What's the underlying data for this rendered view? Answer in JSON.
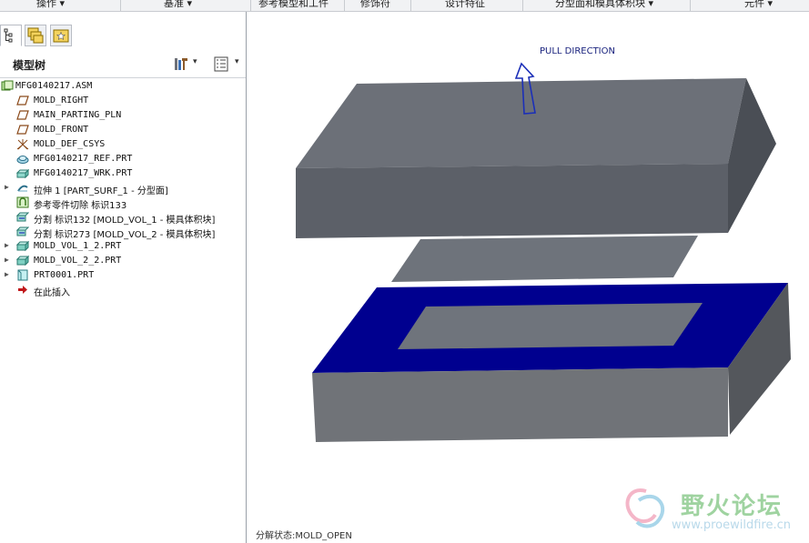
{
  "menubar": {
    "items": [
      {
        "label": "操作",
        "arrow": "▾"
      },
      {
        "label": "基准",
        "arrow": "▾"
      },
      {
        "label": "参考模型和工件",
        "arrow": ""
      },
      {
        "label": "修饰符",
        "arrow": ""
      },
      {
        "label": "设计特征",
        "arrow": ""
      },
      {
        "label": "分型面和模具体积块",
        "arrow": "▾"
      },
      {
        "label": "元件",
        "arrow": "▾"
      }
    ]
  },
  "tabs": [
    {
      "icon": "model-tree-icon"
    },
    {
      "icon": "layers-icon"
    },
    {
      "icon": "favorites-icon"
    }
  ],
  "tree_header": {
    "title": "模型树",
    "settings_icon": "tree-settings-icon",
    "columns_icon": "tree-columns-icon",
    "dropdown": "▾"
  },
  "tree": {
    "items": [
      {
        "label": "MFG0140217.ASM",
        "icon": "assembly-icon",
        "expandable": false,
        "indent": 0
      },
      {
        "label": "MOLD_RIGHT",
        "icon": "datum-plane-icon",
        "expandable": false,
        "indent": 1
      },
      {
        "label": "MAIN_PARTING_PLN",
        "icon": "datum-plane-icon",
        "expandable": false,
        "indent": 1
      },
      {
        "label": "MOLD_FRONT",
        "icon": "datum-plane-icon",
        "expandable": false,
        "indent": 1
      },
      {
        "label": "MOLD_DEF_CSYS",
        "icon": "csys-icon",
        "expandable": false,
        "indent": 1
      },
      {
        "label": "MFG0140217_REF.PRT",
        "icon": "ref-part-icon",
        "expandable": false,
        "indent": 1
      },
      {
        "label": "MFG0140217_WRK.PRT",
        "icon": "workpiece-icon",
        "expandable": false,
        "indent": 1
      },
      {
        "label": "拉伸 1 [PART_SURF_1 - 分型面]",
        "icon": "extrude-icon",
        "expandable": true,
        "indent": 1
      },
      {
        "label": "参考零件切除 标识133",
        "icon": "ref-cut-icon",
        "expandable": false,
        "indent": 1
      },
      {
        "label": "分割 标识132 [MOLD_VOL_1 - 模具体积块]",
        "icon": "split-icon",
        "expandable": false,
        "indent": 1
      },
      {
        "label": "分割 标识273 [MOLD_VOL_2 - 模具体积块]",
        "icon": "split-icon",
        "expandable": false,
        "indent": 1
      },
      {
        "label": "MOLD_VOL_1_2.PRT",
        "icon": "mold-part-icon",
        "expandable": true,
        "indent": 1
      },
      {
        "label": "MOLD_VOL_2_2.PRT",
        "icon": "mold-part-icon",
        "expandable": true,
        "indent": 1
      },
      {
        "label": "PRT0001.PRT",
        "icon": "part-icon",
        "expandable": true,
        "indent": 1
      },
      {
        "label": "在此插入",
        "icon": "insert-here-icon",
        "expandable": false,
        "indent": 1
      }
    ]
  },
  "viewport": {
    "pull_direction_label": "PULL DIRECTION",
    "status_text": "分解状态:MOLD_OPEN",
    "colors": {
      "top_block_top": "#6c7078",
      "top_block_front": "#5c6068",
      "top_block_side": "#4a4e55",
      "parting_sheet": "#6e737b",
      "cavity_top": "#00008f",
      "cavity_front": "#707378",
      "cavity_side": "#54575c",
      "cavity_hole": "#6f747c",
      "arrow": "#1b2fb8"
    }
  },
  "watermark": {
    "chinese": "野火论坛",
    "url": "www.proewildfire.cn"
  }
}
